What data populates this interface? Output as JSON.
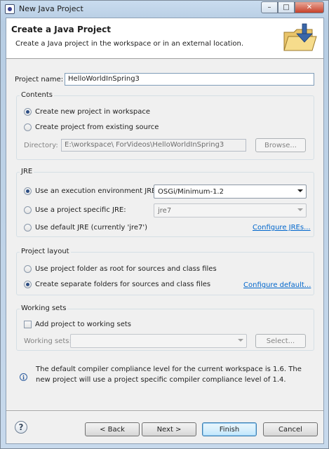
{
  "window": {
    "title": "New Java Project",
    "controls": {
      "minimize": "–",
      "maximize": "□",
      "close": "✕"
    }
  },
  "banner": {
    "title": "Create a Java Project",
    "description": "Create a Java project in the workspace or in an external location.",
    "icon": "folder-java-wizard-icon"
  },
  "project_name": {
    "label": "Project name:",
    "value": "HelloWorldInSpring3"
  },
  "contents": {
    "label": "Contents",
    "create_new": "Create new project in workspace",
    "create_from_existing": "Create project from existing source",
    "selected": "create_new",
    "directory_label": "Directory:",
    "directory_value": "E:\\workspace\\ ForVideos\\HelloWorldInSpring3",
    "browse_label": "Browse..."
  },
  "jre": {
    "label": "JRE",
    "use_exec_env": "Use an execution environment JRE:",
    "exec_env_value": "OSGi/Minimum-1.2",
    "use_project_specific": "Use a project specific JRE:",
    "project_specific_value": "jre7",
    "use_default": "Use default JRE (currently 'jre7')",
    "configure_link": "Configure JREs...",
    "selected": "use_exec_env"
  },
  "layout": {
    "label": "Project layout",
    "use_project_folder": "Use project folder as root for sources and class files",
    "create_separate": "Create separate folders for sources and class files",
    "configure_link": "Configure default...",
    "selected": "create_separate"
  },
  "working_sets": {
    "label": "Working sets",
    "add_to_working_sets": "Add project to working sets",
    "checked": false,
    "working_sets_label": "Working sets:",
    "working_sets_value": "",
    "select_label": "Select..."
  },
  "info": {
    "message": "The default compiler compliance level for the current workspace is 1.6. The new project will use a project specific compiler compliance level of 1.4."
  },
  "footer": {
    "help": "?",
    "back": "< Back",
    "next": "Next >",
    "finish": "Finish",
    "cancel": "Cancel"
  },
  "colors": {
    "title_gradient_top": "#c9dcef",
    "dialog_background": "#f0f0f0",
    "link": "#0066cc",
    "default_button_border": "#3c7fb1"
  }
}
